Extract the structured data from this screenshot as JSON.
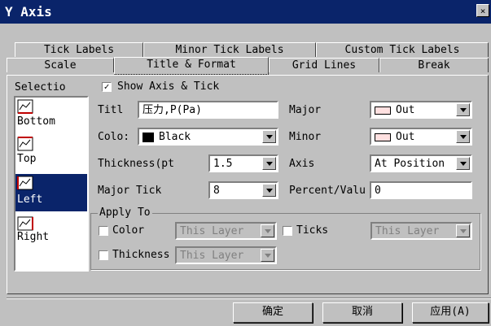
{
  "window": {
    "title": "Y Axis"
  },
  "tabs_row1": [
    "Tick Labels",
    "Minor Tick Labels",
    "Custom Tick Labels"
  ],
  "tabs_row2": [
    "Scale",
    "Title & Format",
    "Grid Lines",
    "Break"
  ],
  "active_tab": "Title & Format",
  "selection": {
    "label": "Selectio",
    "items": [
      "Bottom",
      "Top",
      "Left",
      "Right"
    ],
    "selected": "Left"
  },
  "show_axis": {
    "label": "Show Axis & Tick",
    "checked": true
  },
  "title_field": {
    "label": "Titl",
    "value": "压力,P(Pa)"
  },
  "color": {
    "label": "Colo:",
    "value": "Black"
  },
  "thickness": {
    "label": "Thickness(pt",
    "value": "1.5"
  },
  "major_tick": {
    "label": "Major Tick",
    "value": "8"
  },
  "major": {
    "label": "Major",
    "value": "Out"
  },
  "minor": {
    "label": "Minor",
    "value": "Out"
  },
  "axis": {
    "label": "Axis",
    "value": "At Position"
  },
  "percent": {
    "label": "Percent/Valu",
    "value": "0"
  },
  "apply_to": {
    "label": "Apply To",
    "color_label": "Color",
    "color_value": "This Layer",
    "ticks_label": "Ticks",
    "ticks_value": "This Layer",
    "thickness_label": "Thickness",
    "thickness_value": "This Layer"
  },
  "buttons": {
    "ok": "确定",
    "cancel": "取消",
    "apply": "应用(A)"
  },
  "colors": {
    "titlebar": "#0a246a",
    "face": "#c0c0c0",
    "selection": "#0a246a"
  }
}
